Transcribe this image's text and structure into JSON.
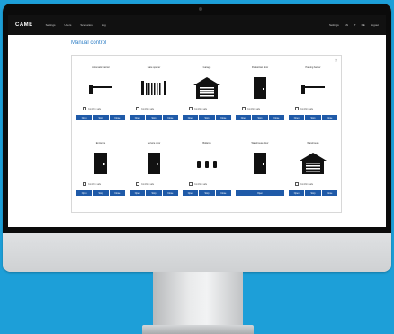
{
  "app": {
    "brand": "CAME"
  },
  "nav": {
    "items": [
      "Settings",
      "Users",
      "Scenarios",
      "Log"
    ],
    "right": [
      "Settings",
      "EN",
      "IT",
      "DE",
      "Logout"
    ]
  },
  "page": {
    "title": "Manual control"
  },
  "panel": {
    "close": "×"
  },
  "cards": [
    {
      "title": "Automatic barrier",
      "icon": "barrier-icon",
      "check": "Confirm safe",
      "buttons": [
        "Open",
        "Stop",
        "Close"
      ]
    },
    {
      "title": "Gate opener",
      "icon": "gate-icon",
      "check": "Confirm safe",
      "buttons": [
        "Open",
        "Stop",
        "Close"
      ]
    },
    {
      "title": "Garage",
      "icon": "garage-icon",
      "check": "Confirm safe",
      "buttons": [
        "Open",
        "Stop",
        "Close"
      ]
    },
    {
      "title": "Pedestrian door",
      "icon": "door-icon",
      "check": "Confirm safe",
      "buttons": [
        "Open",
        "Stop",
        "Close"
      ]
    },
    {
      "title": "Parking barrier",
      "icon": "barrier-icon",
      "check": "Confirm safe",
      "buttons": [
        "Open",
        "Stop",
        "Close"
      ]
    },
    {
      "title": "Entrance",
      "icon": "door-icon",
      "check": "Confirm safe",
      "buttons": [
        "Open",
        "Stop",
        "Close"
      ]
    },
    {
      "title": "Service door",
      "icon": "door-icon",
      "check": "Confirm safe",
      "buttons": [
        "Open",
        "Stop",
        "Close"
      ]
    },
    {
      "title": "Bollards",
      "icon": "bollards-icon",
      "check": "Confirm safe",
      "buttons": [
        "Open",
        "Stop",
        "Close"
      ]
    },
    {
      "title": "Warehouse door",
      "icon": "door-icon",
      "check": "",
      "buttons": [
        "Open"
      ]
    },
    {
      "title": "Warehouse",
      "icon": "garage-icon",
      "check": "Confirm safe",
      "buttons": [
        "Open",
        "Stop",
        "Close"
      ]
    }
  ]
}
